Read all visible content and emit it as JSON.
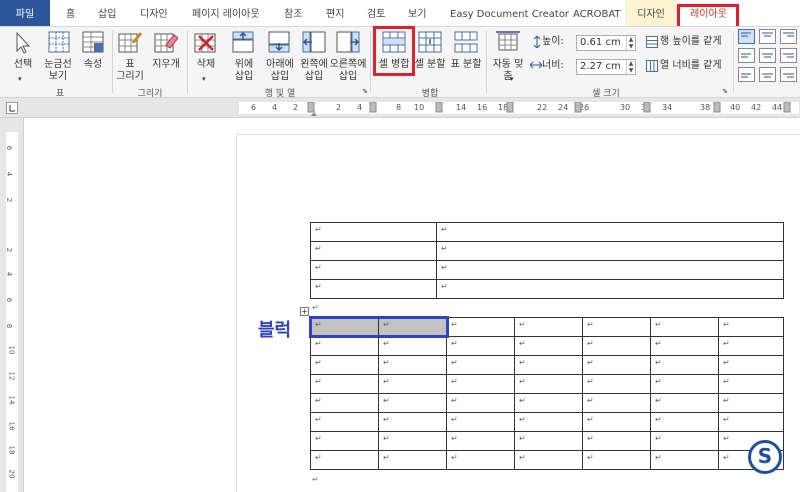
{
  "tabs": [
    {
      "label": "파일"
    },
    {
      "label": "홈"
    },
    {
      "label": "삽입"
    },
    {
      "label": "디자인"
    },
    {
      "label": "페이지 레이아웃"
    },
    {
      "label": "참조"
    },
    {
      "label": "편지"
    },
    {
      "label": "검토"
    },
    {
      "label": "보기"
    },
    {
      "label": "Easy Document Creator"
    },
    {
      "label": "ACROBAT"
    },
    {
      "label": "디자인"
    },
    {
      "label": "레이아웃"
    }
  ],
  "ribbon": {
    "select_label": "선택",
    "gridlines_label": "눈금선\n보기",
    "properties_label": "속성",
    "group_table": "표",
    "draw_table_label": "표\n그리기",
    "eraser_label": "지우개",
    "group_draw": "그리기",
    "delete_label": "삭제",
    "insert_above_label": "위에\n삽입",
    "insert_below_label": "아래에\n삽입",
    "insert_left_label": "왼쪽에\n삽입",
    "insert_right_label": "오른쪽에\n삽입",
    "group_rows_cols": "행 및 열",
    "merge_cells_label": "셀 병합",
    "split_cells_label": "셀 분할",
    "split_table_label": "표 분할",
    "group_merge": "병합",
    "autofit_label": "자동 맞\n춤",
    "height_label": "높이:",
    "height_value": "0.61 cm",
    "width_label": "너비:",
    "width_value": "2.27 cm",
    "distribute_rows_label": "행 높이를 같게",
    "distribute_cols_label": "열 너비를 같게",
    "group_cell_size": "셀 크기"
  },
  "ruler_h": [
    "6",
    "4",
    "2",
    "",
    "2",
    "4",
    "8",
    "10",
    "14",
    "16",
    "18",
    "22",
    "24",
    "26",
    "30",
    "32",
    "34",
    "38",
    "40",
    "42",
    "44"
  ],
  "ruler_v": [
    "6",
    "4",
    "2",
    "",
    "2",
    "4",
    "6",
    "8",
    "10",
    "12",
    "14",
    "16",
    "18",
    "20"
  ],
  "annotation_label": "블럭",
  "paragraph_mark": "↵",
  "badge_letter": "S",
  "colors": {
    "file_tab": "#2b579a",
    "highlight_red": "#e0202a",
    "highlight_blue": "#2f43bd",
    "selection_gray": "#c2c2c2"
  }
}
